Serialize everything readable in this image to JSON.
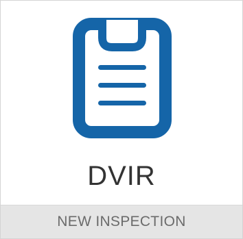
{
  "card": {
    "title": "DVIR",
    "action_label": "NEW INSPECTION",
    "icon": "clipboard-icon"
  },
  "colors": {
    "icon_blue": "#1565a8",
    "title_text": "#333333",
    "footer_bg": "#e5e5e5",
    "footer_text": "#6b6b6b",
    "border": "#d4d4d4"
  }
}
